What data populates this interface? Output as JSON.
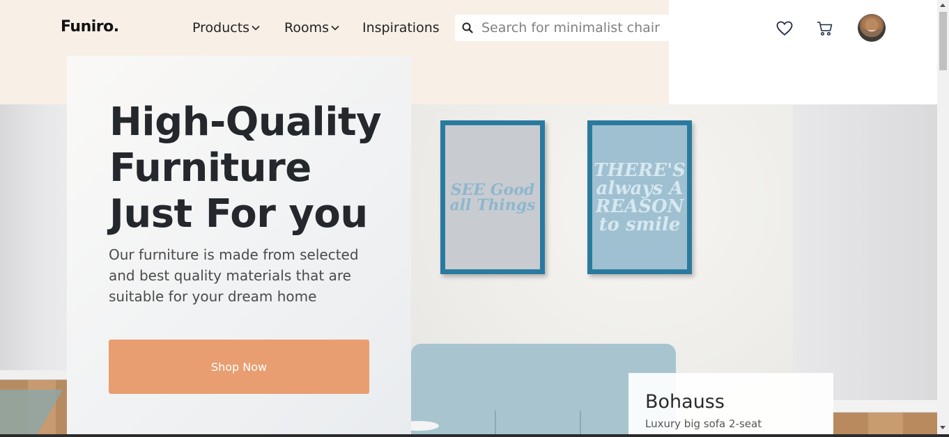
{
  "nav": {
    "logo": "Funiro.",
    "products": "Products",
    "rooms": "Rooms",
    "inspirations": "Inspirations",
    "search_placeholder": "Search for minimalist chair"
  },
  "hero": {
    "title": "High-Quality Furniture Just For you",
    "subtitle": "Our furniture is made from selected and best quality materials that are suitable for your dream home",
    "cta": "Shop Now"
  },
  "frames": {
    "left_art": "SEE Good all Things",
    "right_art": "THERE'S always A REASON to smile"
  },
  "product": {
    "name": "Bohauss",
    "description": "Luxury big sofa 2-seat"
  },
  "colors": {
    "accent": "#e89e70",
    "header_bg": "#f8efe7",
    "frame": "#2a7aa0"
  },
  "icons": [
    "search-icon",
    "chevron-down-icon",
    "heart-icon",
    "cart-icon",
    "avatar"
  ]
}
